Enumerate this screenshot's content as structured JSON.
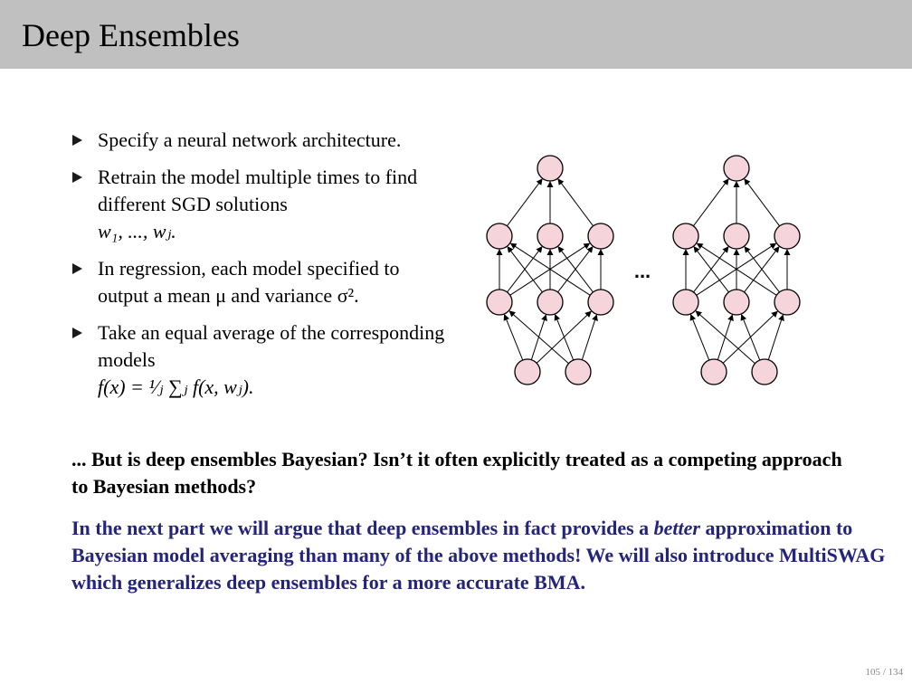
{
  "header": {
    "title": "Deep Ensembles"
  },
  "bullets": [
    {
      "text": "Specify a neural network architecture."
    },
    {
      "text": "Retrain the model multiple times to find different SGD solutions",
      "math": "w₁, ..., wⱼ."
    },
    {
      "text": "In regression, each model specified to output a mean μ and variance σ²."
    },
    {
      "text": "Take an equal average of the corresponding models",
      "math": "f(x) = ¹⁄ⱼ ∑ⱼ f(x, wⱼ)."
    }
  ],
  "question": "... But is deep ensembles Bayesian? Isn’t it often explicitly treated as a competing approach to Bayesian methods?",
  "blue_text": {
    "part1": "In the next part we will argue that deep ensembles in fact provides a ",
    "emph": "better",
    "part2": " approximation to Bayesian model averaging than many of the above methods! We will also introduce MultiSWAG which generalizes deep ensembles for a more accurate BMA."
  },
  "figure": {
    "ellipsis": "...",
    "node_fill": "#f5d5db"
  },
  "page_number": "105 / 134"
}
